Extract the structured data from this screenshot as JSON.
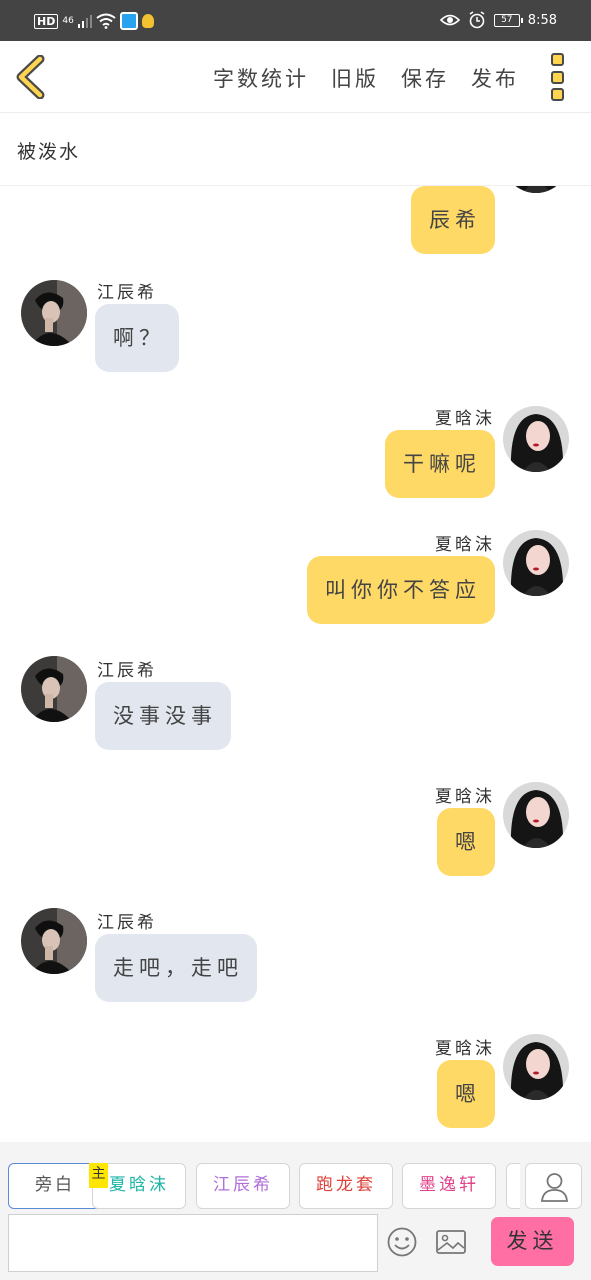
{
  "status_bar": {
    "hd": "HD",
    "signal": "46",
    "battery": "57",
    "time": "8:58"
  },
  "toolbar": {
    "word_count": "字数统计",
    "old_version": "旧版",
    "save": "保存",
    "publish": "发布"
  },
  "chapter": {
    "title": "被泼水"
  },
  "messages": [
    {
      "side": "right",
      "name": "",
      "text": "辰希"
    },
    {
      "side": "left",
      "name": "江辰希",
      "text": "啊？"
    },
    {
      "side": "right",
      "name": "夏晗沫",
      "text": "干嘛呢"
    },
    {
      "side": "right",
      "name": "夏晗沫",
      "text": "叫你你不答应"
    },
    {
      "side": "left",
      "name": "江辰希",
      "text": "没事没事"
    },
    {
      "side": "right",
      "name": "夏晗沫",
      "text": "嗯"
    },
    {
      "side": "left",
      "name": "江辰希",
      "text": "走吧，走吧"
    },
    {
      "side": "right",
      "name": "夏晗沫",
      "text": "嗯"
    }
  ],
  "characters": [
    {
      "label": "旁白",
      "color": "#555555",
      "active": true
    },
    {
      "label": "夏晗沫",
      "color": "#1fb5a8",
      "badge": "主"
    },
    {
      "label": "江辰希",
      "color": "#b06fd8"
    },
    {
      "label": "跑龙套",
      "color": "#e0413a"
    },
    {
      "label": "墨逸轩",
      "color": "#e0448c"
    }
  ],
  "composer": {
    "input_value": "",
    "send_label": "发送"
  }
}
